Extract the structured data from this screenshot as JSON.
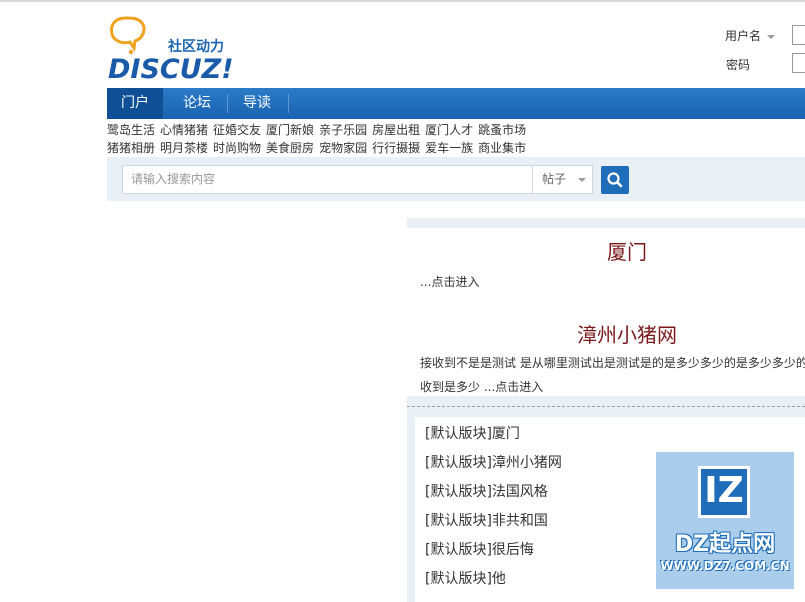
{
  "header": {
    "logo_tagline": "社区动力",
    "logo_word": "DISCUZ!",
    "username_label": "用户名",
    "password_label": "密码"
  },
  "nav": {
    "items": [
      {
        "label": "门户",
        "active": true
      },
      {
        "label": "论坛",
        "active": false
      },
      {
        "label": "导读",
        "active": false
      }
    ]
  },
  "quicklinks": {
    "row1": [
      "鹭岛生活",
      "心情猪猪",
      "征婚交友",
      "厦门新娘",
      "亲子乐园",
      "房屋出租",
      "厦门人才",
      "跳蚤市场"
    ],
    "row2": [
      "猪猪相册",
      "明月茶楼",
      "时尚购物",
      "美食厨房",
      "宠物家园",
      "行行摄摄",
      "爱车一族",
      "商业集市"
    ]
  },
  "search": {
    "placeholder": "请输入搜索内容",
    "type_selected": "帖子"
  },
  "articles": [
    {
      "title": "厦门",
      "summary_line1": "...点击进入",
      "summary_line2": ""
    },
    {
      "title": "漳州小猪网",
      "summary_line1": "接收到不是是测试  是从哪里测试出是测试是的是多少多少的是多少多少的",
      "summary_line2": "收到是多少  ...点击进入"
    }
  ],
  "thread_list": [
    "[默认版块]厦门",
    "[默认版块]漳州小猪网",
    "[默认版块]法国风格",
    "[默认版块]非共和国",
    "[默认版块]很后悔",
    "[默认版块]他"
  ],
  "watermark": {
    "mark": "IZ",
    "name": "DZ起点网",
    "url": "WWW.DZ7.COM.CN"
  },
  "colors": {
    "nav_blue": "#1a63b0",
    "title_red": "#7b1a1a",
    "panel_bg": "#e8eff5"
  }
}
